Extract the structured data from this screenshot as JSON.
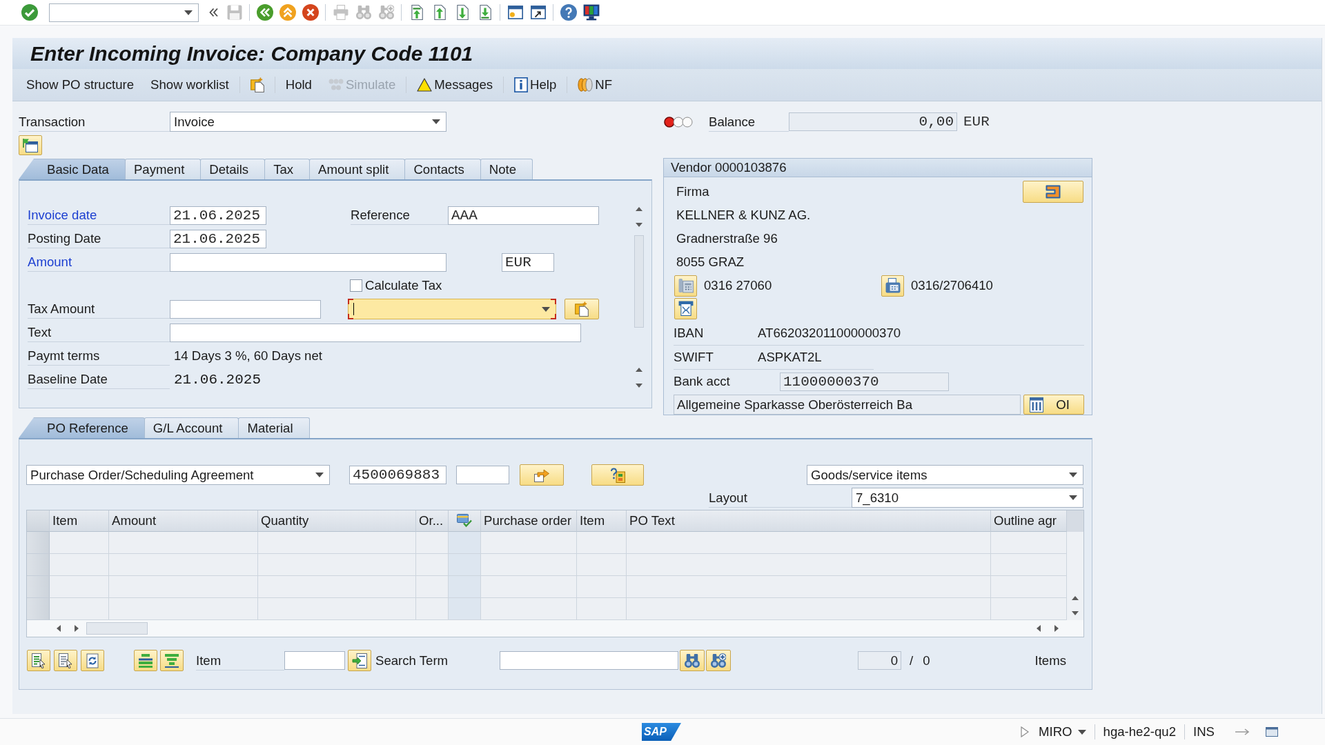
{
  "system_toolbar": {
    "groups": [
      [
        {
          "disabled": false
        }
      ],
      [
        {
          "disabled": false
        },
        {
          "disabled": true
        }
      ],
      [
        {
          "disabled": false
        },
        {
          "disabled": false
        },
        {
          "disabled": false
        }
      ],
      [
        {
          "disabled": true
        },
        {
          "disabled": true
        },
        {
          "disabled": true
        }
      ],
      [
        {
          "disabled": false
        },
        {
          "disabled": false
        },
        {
          "disabled": false
        },
        {
          "disabled": false
        }
      ],
      [
        {
          "disabled": false
        },
        {
          "disabled": false
        }
      ],
      [
        {
          "disabled": false
        },
        {
          "disabled": false
        }
      ]
    ]
  },
  "title": "Enter Incoming Invoice: Company Code 1101",
  "app_toolbar": {
    "groups": [
      [
        {
          "label": "Show PO structure",
          "disabled": false
        },
        {
          "label": "Show worklist",
          "disabled": false
        }
      ],
      [
        {
          "disabled": false
        }
      ],
      [
        {
          "label": "Hold",
          "disabled": false
        },
        {
          "label": "Simulate",
          "disabled": true
        }
      ],
      [
        {
          "label": "Messages",
          "disabled": false
        }
      ],
      [
        {
          "label": "Help",
          "disabled": false
        }
      ],
      [
        {
          "label": "NF",
          "disabled": false
        }
      ]
    ]
  },
  "header": {
    "transaction": {
      "label": "Transaction",
      "value": "Invoice"
    },
    "balance": {
      "lights": [
        {
          "on": true
        },
        {
          "on": false
        },
        {
          "on": false
        }
      ],
      "label": "Balance",
      "value": "0,00",
      "read_only": true,
      "currency": "EUR"
    }
  },
  "invoice_tabs": [
    {
      "label": "Basic Data",
      "selected": true
    },
    {
      "label": "Payment",
      "selected": false
    },
    {
      "label": "Details",
      "selected": false
    },
    {
      "label": "Tax",
      "selected": false
    },
    {
      "label": "Amount split",
      "selected": false
    },
    {
      "label": "Contacts",
      "selected": false
    },
    {
      "label": "Note",
      "selected": false
    }
  ],
  "basic_data": {
    "invoice_date": {
      "label": "Invoice date",
      "emphasized": true,
      "value": "21.06.2025"
    },
    "reference": {
      "label": "Reference",
      "emphasized": false,
      "value": "AAA"
    },
    "posting_date": {
      "label": "Posting Date",
      "emphasized": false,
      "value": "21.06.2025"
    },
    "amount": {
      "label": "Amount",
      "emphasized": true
    },
    "currency": {
      "value": "EUR"
    },
    "calculate_tax": {
      "label": "Calculate Tax",
      "checked": false
    },
    "tax_amount": {
      "label": "Tax Amount",
      "emphasized": false
    },
    "tax_code": {
      "focused": true
    },
    "text": {
      "label": "Text",
      "emphasized": false
    },
    "payment_terms": {
      "label": "Paymt terms",
      "emphasized": false,
      "value": "14 Days 3 %, 60 Days net"
    },
    "baseline_date": {
      "label": "Baseline Date",
      "emphasized": false,
      "value": "21.06.2025"
    }
  },
  "vendor": {
    "title": "Vendor 0000103876",
    "address_lines": [
      "Firma",
      "KELLNER & KUNZ AG.",
      "Gradnerstraße 96",
      "8055 GRAZ"
    ],
    "phone": "0316 27060",
    "fax": "0316/2706410",
    "iban": {
      "label": "IBAN",
      "value": "AT662032011000000370"
    },
    "swift": {
      "label": "SWIFT",
      "value": "ASPKAT2L"
    },
    "bank_account": {
      "label": "Bank acct",
      "value": "11000000370",
      "read_only": true
    },
    "bank_name": {
      "value": "Allgemeine Sparkasse Oberösterreich Ba",
      "read_only": true
    },
    "bank_button": {
      "label": "OI"
    }
  },
  "item_tabs": [
    {
      "label": "PO Reference",
      "selected": true
    },
    {
      "label": "G/L Account",
      "selected": false
    },
    {
      "label": "Material",
      "selected": false
    }
  ],
  "po_reference": {
    "reference_type": {
      "value": "Purchase Order/Scheduling Agreement"
    },
    "document_number": {
      "value": "4500069883"
    },
    "item_view": {
      "value": "Goods/service items"
    },
    "layout": {
      "label": "Layout",
      "value": "7_6310"
    },
    "table": {
      "columns": [
        {
          "kind": "text",
          "label": "Item"
        },
        {
          "kind": "text",
          "label": "Amount"
        },
        {
          "kind": "text",
          "label": "Quantity"
        },
        {
          "kind": "text",
          "label": "Or..."
        },
        {
          "kind": "icon"
        },
        {
          "kind": "text",
          "label": "Purchase order"
        },
        {
          "kind": "text",
          "label": "Item"
        },
        {
          "kind": "text",
          "label": "PO Text"
        },
        {
          "kind": "text",
          "label": "Outline agr"
        }
      ]
    },
    "footer": {
      "item_label": "Item",
      "search_label": "Search Term",
      "count": {
        "value": "0",
        "read_only": true
      },
      "separator": "/",
      "total": "0",
      "items_label": "Items"
    }
  },
  "status_bar": {
    "logo": "SAP",
    "transaction": "MIRO",
    "system": "hga-he2-qu2",
    "mode": "INS"
  }
}
